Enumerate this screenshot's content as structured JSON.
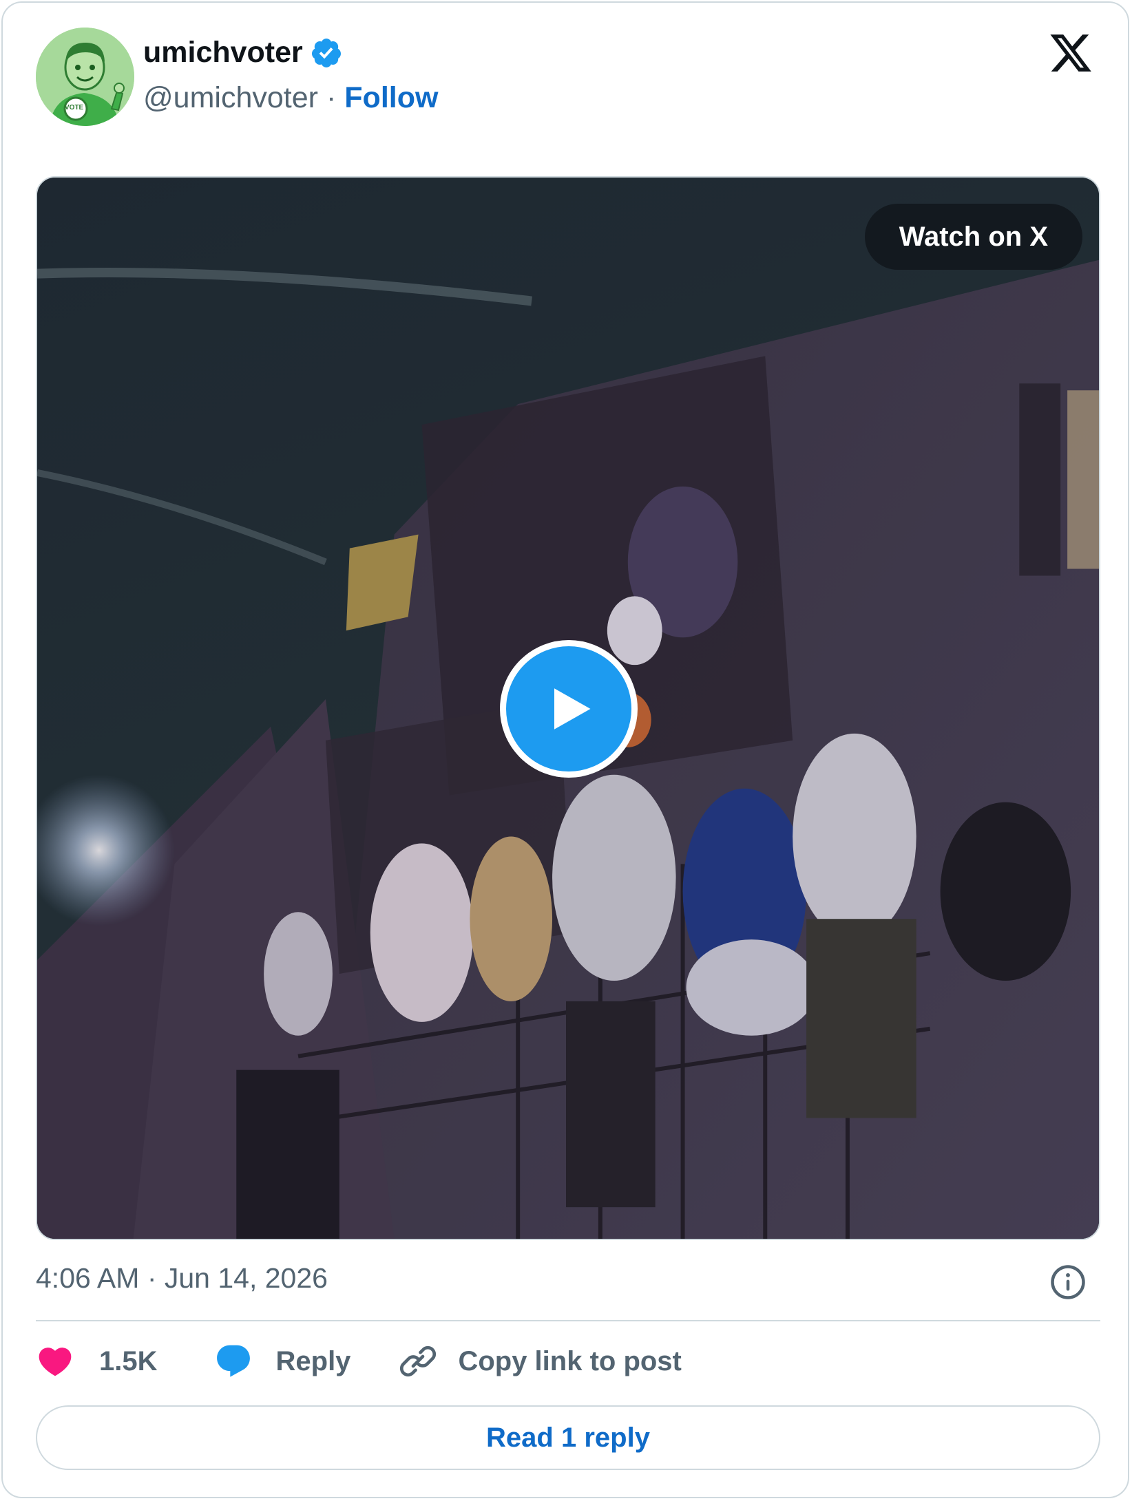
{
  "author": {
    "display_name": "umichvoter",
    "handle": "@umichvoter",
    "separator": "·",
    "follow_label": "Follow",
    "avatar_text": "VOTE",
    "verified_color": "#1d9bf0"
  },
  "media": {
    "watch_label": "Watch on X",
    "play_icon": "play-icon"
  },
  "meta": {
    "timestamp": "4:06 AM · Jun 14, 2026"
  },
  "actions": {
    "like_count": "1.5K",
    "reply_label": "Reply",
    "copy_label": "Copy link to post"
  },
  "read_replies_label": "Read 1 reply",
  "colors": {
    "accent": "#0f6bc8",
    "like": "#f91880",
    "reply_icon": "#1d9bf0",
    "muted": "#536471",
    "border": "#cfd9de"
  }
}
